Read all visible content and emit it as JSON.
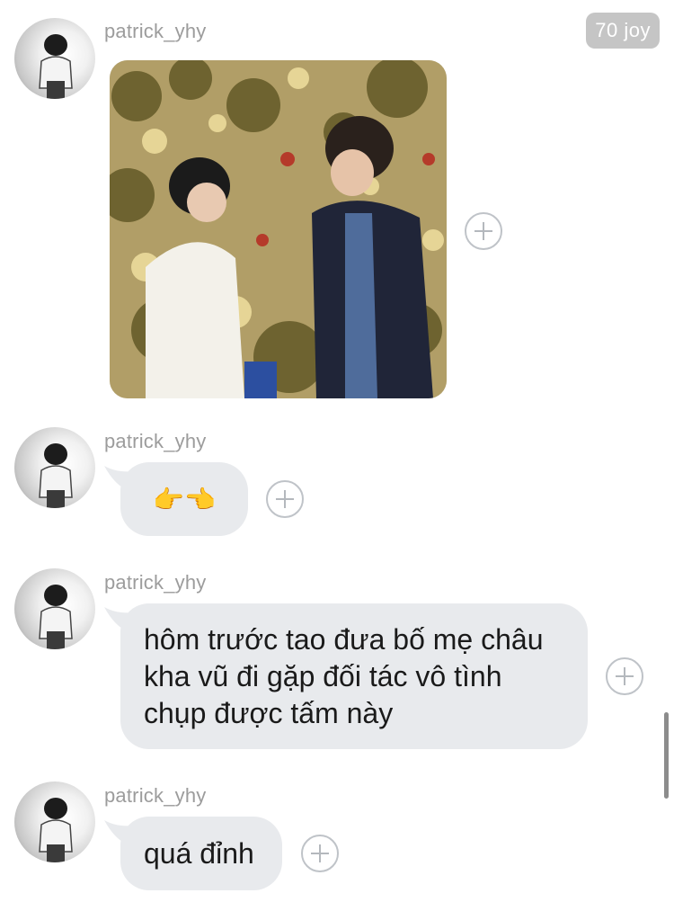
{
  "header": {
    "joy_badge": "70 joy"
  },
  "messages": [
    {
      "username": "patrick_yhy",
      "type": "image",
      "image_icon": "photo-two-people-in-orchard"
    },
    {
      "username": "patrick_yhy",
      "type": "text",
      "text": "👉👈"
    },
    {
      "username": "patrick_yhy",
      "type": "text",
      "text_lines": [
        "hôm trước tao đưa bố mẹ châu",
        "kha vũ đi gặp đối tác vô tình",
        "chụp được tấm này"
      ]
    },
    {
      "username": "patrick_yhy",
      "type": "text",
      "text": "quá đỉnh"
    }
  ],
  "icons": {
    "add_reaction": "plus-circle-icon",
    "avatar": "user-avatar"
  },
  "colors": {
    "bubble": "#e8eaed",
    "username": "#9c9c9c",
    "badge": "#c5c5c5"
  }
}
